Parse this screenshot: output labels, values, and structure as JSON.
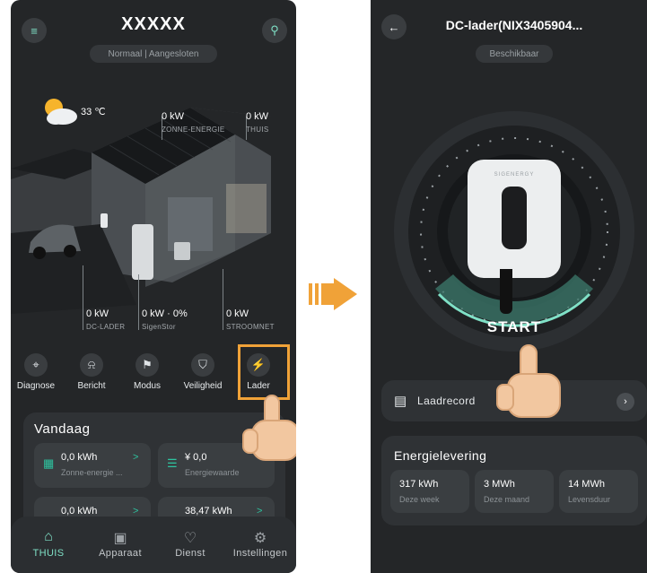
{
  "left": {
    "title": "XXXXX",
    "status": "Normaal | Aangesloten",
    "weather": {
      "temp": "33 ℃",
      "icon": "sun-cloud-icon"
    },
    "stats": {
      "solar": {
        "value": "0 kW",
        "label": "ZONNE-ENERGIE"
      },
      "home": {
        "value": "0 kW",
        "label": "THUIS"
      },
      "dc_charger": {
        "value": "0 kW",
        "label": "DC-LADER"
      },
      "storage": {
        "value": "0 kW · 0%",
        "label": "SigenStor"
      },
      "grid": {
        "value": "0 kW",
        "label": "STROOMNET"
      }
    },
    "quick_actions": [
      {
        "label": "Diagnose",
        "icon": "diagnose-icon"
      },
      {
        "label": "Bericht",
        "icon": "bell-icon"
      },
      {
        "label": "Modus",
        "icon": "mode-icon"
      },
      {
        "label": "Veiligheid",
        "icon": "shield-icon"
      },
      {
        "label": "Lader",
        "icon": "charger-icon"
      }
    ],
    "today": {
      "heading": "Vandaag",
      "tiles": [
        {
          "value": "0,0 kWh",
          "label": "Zonne-energie ...",
          "arrow": ">"
        },
        {
          "value": "¥ 0,0",
          "label": "Energiewaarde"
        },
        {
          "value": "0,0 kWh",
          "label": "",
          "arrow": ">"
        },
        {
          "value": "38,47 kWh",
          "label": "",
          "arrow": ">"
        }
      ]
    },
    "tabs": [
      {
        "label": "THUIS",
        "icon": "home-icon",
        "active": true
      },
      {
        "label": "Apparaat",
        "icon": "device-icon"
      },
      {
        "label": "Dienst",
        "icon": "service-icon"
      },
      {
        "label": "Instellingen",
        "icon": "gear-icon"
      }
    ]
  },
  "right": {
    "title": "DC-lader(NIX3405904...",
    "status": "Beschikbaar",
    "charger_brand": "SIGENERGY",
    "start_label": "START",
    "record_label": "Laadrecord",
    "delivery": {
      "heading": "Energielevering",
      "items": [
        {
          "value": "317 kWh",
          "label": "Deze week"
        },
        {
          "value": "3 MWh",
          "label": "Deze maand"
        },
        {
          "value": "14 MWh",
          "label": "Levensduur"
        }
      ]
    }
  },
  "colors": {
    "accent": "#7fe0c6",
    "highlight": "#f0a238",
    "background": "#242628",
    "card": "#2f3235"
  }
}
